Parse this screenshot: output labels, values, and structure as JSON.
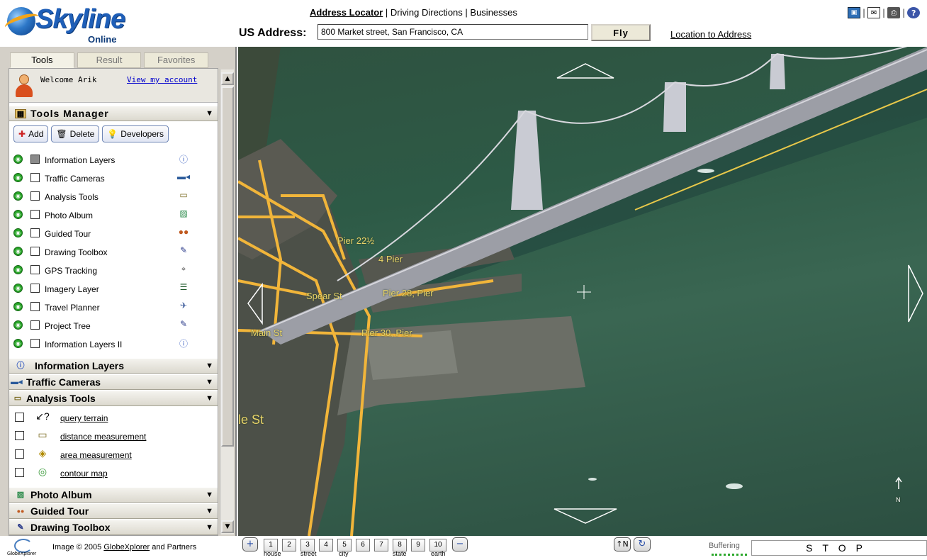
{
  "header": {
    "brand": "Skyline",
    "brand_sub": "Online",
    "nav": {
      "address_locator": "Address Locator",
      "sep1": " | ",
      "driving_directions": "Driving Directions",
      "sep2": " | ",
      "businesses": "Businesses"
    },
    "address_label": "US Address:",
    "address_value": "800 Market street, San Francisco, CA",
    "fly_label": "Fly",
    "location_to_address": "Location to Address",
    "icons": [
      "save-icon",
      "mail-icon",
      "print-icon",
      "help-icon"
    ]
  },
  "tabs": [
    "Tools",
    "Result",
    "Favorites"
  ],
  "welcome": {
    "text": "Welcome Arik",
    "account_link": "View my account"
  },
  "tools_manager": {
    "title": "Tools Manager",
    "buttons": {
      "add": "Add",
      "delete": "Delete",
      "developers": "Developers"
    },
    "items": [
      {
        "label": "Information Layers",
        "icon": "info-icon"
      },
      {
        "label": "Traffic Cameras",
        "icon": "camera-icon"
      },
      {
        "label": "Analysis Tools",
        "icon": "ruler-icon"
      },
      {
        "label": "Photo Album",
        "icon": "photo-icon"
      },
      {
        "label": "Guided Tour",
        "icon": "people-icon"
      },
      {
        "label": "Drawing Toolbox",
        "icon": "pen-icon"
      },
      {
        "label": "GPS Tracking",
        "icon": "satellite-icon"
      },
      {
        "label": "Imagery Layer",
        "icon": "layers-icon"
      },
      {
        "label": "Travel Planner",
        "icon": "plane-icon"
      },
      {
        "label": "Project Tree",
        "icon": "pen-icon"
      },
      {
        "label": "Information Layers II",
        "icon": "info-icon"
      }
    ]
  },
  "sections": {
    "information_layers": "Information Layers",
    "traffic_cameras": "Traffic Cameras",
    "analysis_tools": "Analysis Tools",
    "photo_album": "Photo Album",
    "guided_tour": "Guided Tour",
    "drawing_toolbox": "Drawing Toolbox"
  },
  "analysis_items": [
    {
      "label": "query terrain",
      "icon": "query-terrain-icon"
    },
    {
      "label": "distance measurement",
      "icon": "ruler-icon"
    },
    {
      "label": "area measurement",
      "icon": "area-icon"
    },
    {
      "label": "contour map",
      "icon": "contour-icon"
    }
  ],
  "footer": {
    "globexplorer_logo": "GlobeXplorer",
    "credit_prefix": "Image © 2005 ",
    "credit_link": "GlobeXplorer",
    "credit_suffix": " and Partners"
  },
  "map": {
    "labels": {
      "pier_22": "Pier 22½",
      "pier_24": "4 Pier",
      "pier_28": "Pier 28, Pier",
      "spear_st": "Spear St",
      "main_st": "Main St",
      "pier_30": "Pier 30, Pier",
      "le_st": "le St",
      "north": "N"
    }
  },
  "bottombar": {
    "zoom_levels": [
      "1",
      "2",
      "3",
      "4",
      "5",
      "6",
      "7",
      "8",
      "9",
      "10"
    ],
    "zoom_labels": {
      "house": "house",
      "street": "street",
      "city": "city",
      "state": "state",
      "earth": "earth"
    },
    "zoom_in": "+",
    "zoom_out": "−",
    "north_btn": "↑N",
    "rotate_btn": "↻",
    "buffering": "Buffering",
    "stop": "STOP"
  }
}
